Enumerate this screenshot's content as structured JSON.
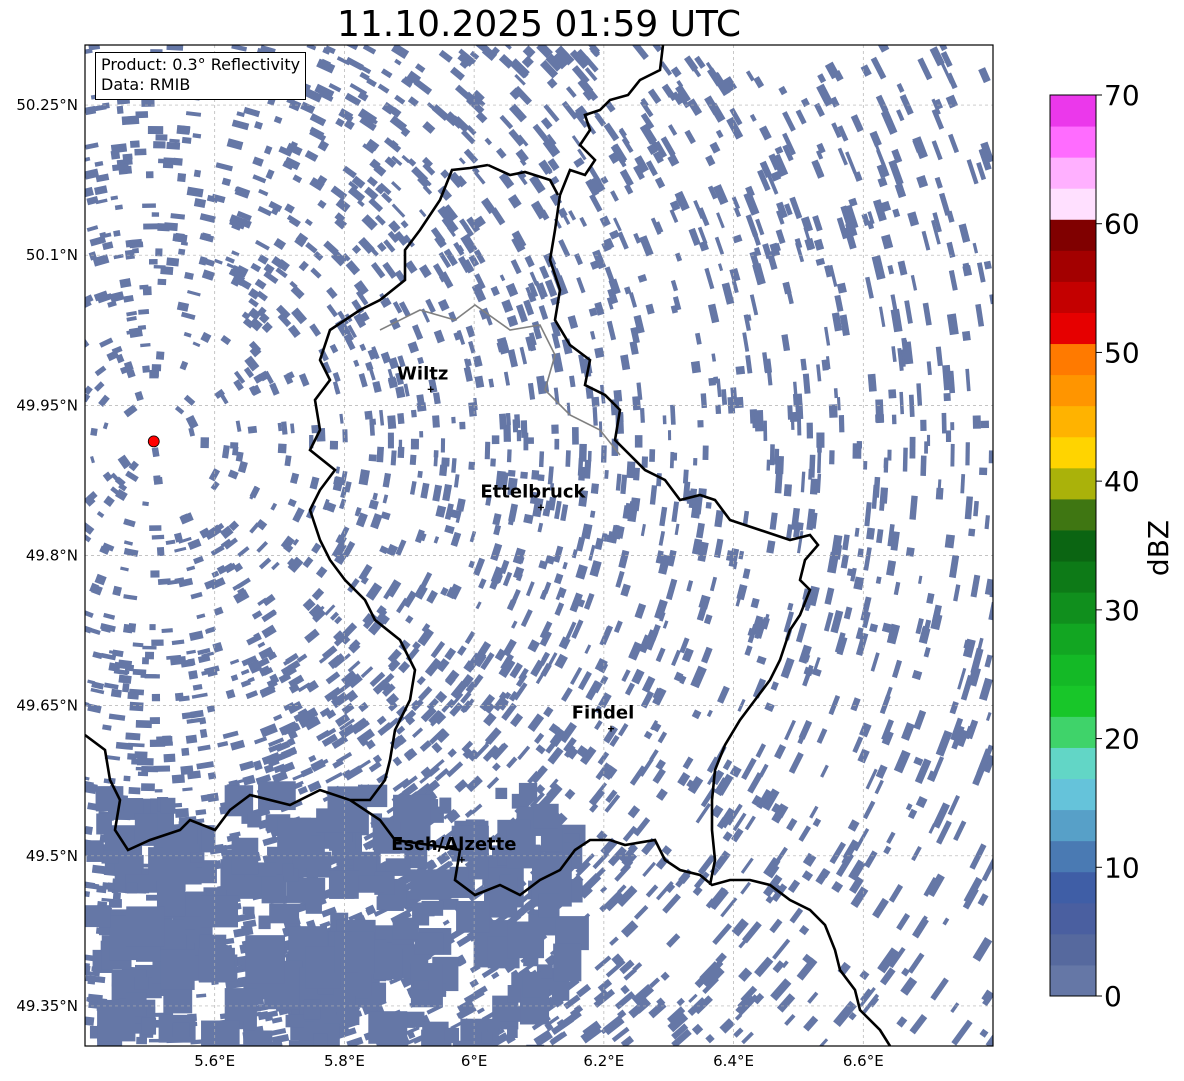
{
  "title": "11.10.2025 01:59 UTC",
  "info": {
    "product": "Product: 0.3° Reflectivity",
    "data": "Data: RMIB"
  },
  "map": {
    "lon_range": [
      5.4,
      6.8
    ],
    "lat_range": [
      49.31,
      50.31
    ],
    "lat_ticks": [
      {
        "value": 50.25,
        "label": "50.25°N"
      },
      {
        "value": 50.1,
        "label": "50.1°N"
      },
      {
        "value": 49.95,
        "label": "49.95°N"
      },
      {
        "value": 49.8,
        "label": "49.8°N"
      },
      {
        "value": 49.65,
        "label": "49.65°N"
      },
      {
        "value": 49.5,
        "label": "49.5°N"
      },
      {
        "value": 49.35,
        "label": "49.35°N"
      }
    ],
    "lon_ticks": [
      {
        "value": 5.6,
        "label": "5.6°E"
      },
      {
        "value": 5.8,
        "label": "5.8°E"
      },
      {
        "value": 6.0,
        "label": "6°E"
      },
      {
        "value": 6.2,
        "label": "6.2°E"
      },
      {
        "value": 6.4,
        "label": "6.4°E"
      },
      {
        "value": 6.6,
        "label": "6.6°E"
      }
    ],
    "radar_site": {
      "lon": 5.506,
      "lat": 49.914,
      "color": "#ff0000"
    },
    "cities": [
      {
        "name": "Wiltz",
        "lon": 5.933,
        "lat": 49.966
      },
      {
        "name": "Ettelbruck",
        "lon": 6.103,
        "lat": 49.848
      },
      {
        "name": "Findel",
        "lon": 6.211,
        "lat": 49.627
      },
      {
        "name": "Esch/Alzette",
        "lon": 5.981,
        "lat": 49.496
      }
    ],
    "echo_color": "#6577a6",
    "grid": true
  },
  "colorbar": {
    "label": "dBZ",
    "ticks": [
      {
        "value": 0,
        "label": "0"
      },
      {
        "value": 10,
        "label": "10"
      },
      {
        "value": 20,
        "label": "20"
      },
      {
        "value": 30,
        "label": "30"
      },
      {
        "value": 40,
        "label": "40"
      },
      {
        "value": 50,
        "label": "50"
      },
      {
        "value": 60,
        "label": "60"
      },
      {
        "value": 70,
        "label": "70"
      }
    ],
    "min": 0,
    "max": 70,
    "colors": [
      "#6577a6",
      "#56699e",
      "#4a5fa0",
      "#3f5ea6",
      "#4a7ab3",
      "#57a0c8",
      "#65c3da",
      "#62d6c6",
      "#3fd36a",
      "#18c629",
      "#14b926",
      "#12a622",
      "#108f1d",
      "#0d7a17",
      "#0b6512",
      "#3f7612",
      "#aab20a",
      "#ffd400",
      "#ffb300",
      "#ff9500",
      "#ff7a00",
      "#e60000",
      "#c40000",
      "#a30000",
      "#800000",
      "#ffe0ff",
      "#ffb0ff",
      "#ff6cff",
      "#eb38eb"
    ]
  }
}
